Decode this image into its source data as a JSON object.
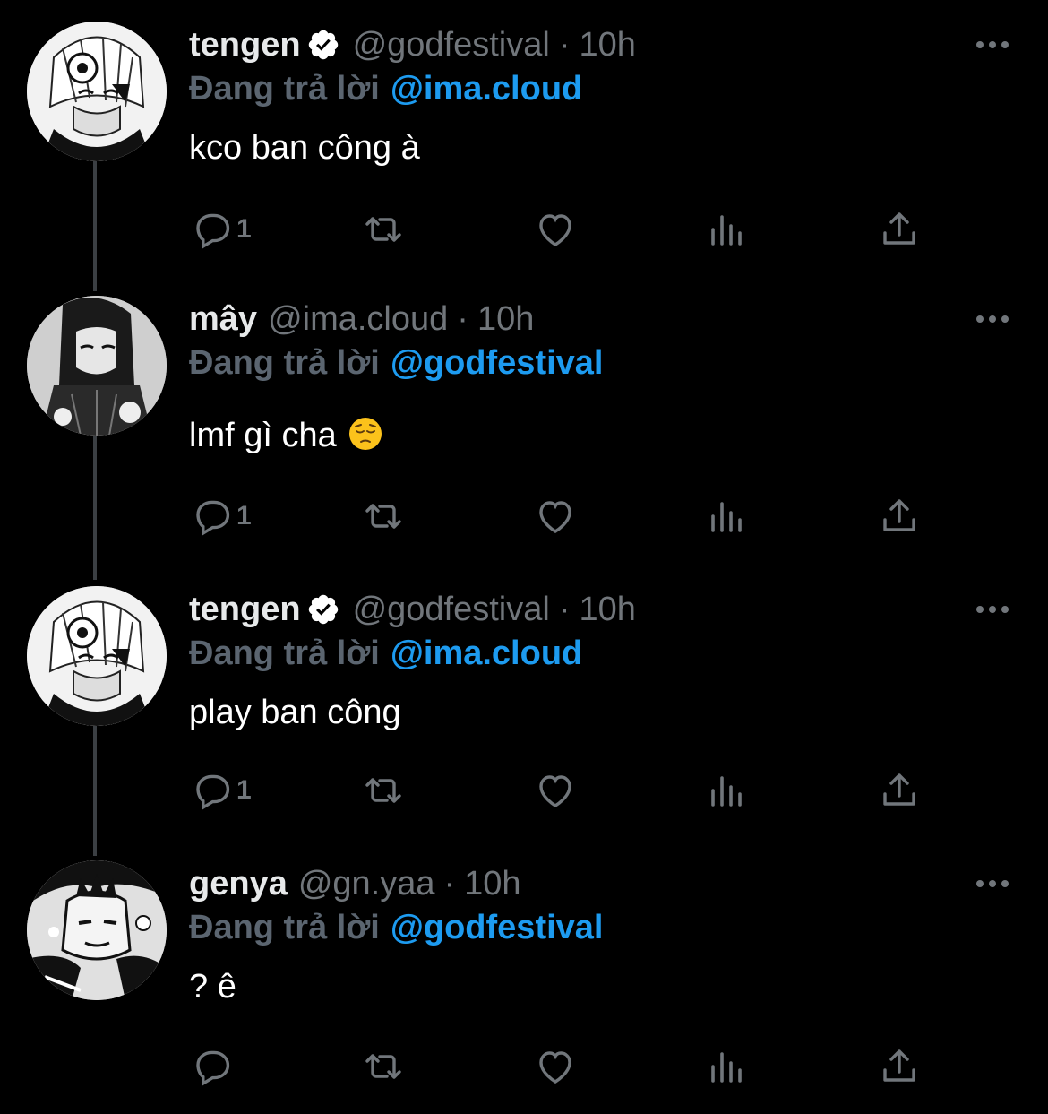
{
  "tweets": [
    {
      "name": "tengen",
      "verified": true,
      "handle": "@godfestival",
      "dot": "·",
      "time": "10h",
      "reply_prefix": "Đang trả lời",
      "reply_to": "@ima.cloud",
      "text": "kco ban công à",
      "emoji": "",
      "reply_count": "1",
      "avatar": "tengen-avatar"
    },
    {
      "name": "mây",
      "verified": false,
      "handle": "@ima.cloud",
      "dot": "·",
      "time": "10h",
      "reply_prefix": "Đang trả lời",
      "reply_to": "@godfestival",
      "text": "lmf gì cha",
      "emoji": "pensive-face",
      "reply_count": "1",
      "avatar": "may-avatar"
    },
    {
      "name": "tengen",
      "verified": true,
      "handle": "@godfestival",
      "dot": "·",
      "time": "10h",
      "reply_prefix": "Đang trả lời",
      "reply_to": "@ima.cloud",
      "text": "play ban công",
      "emoji": "",
      "reply_count": "1",
      "avatar": "tengen-avatar"
    },
    {
      "name": "genya",
      "verified": false,
      "handle": "@gn.yaa",
      "dot": "·",
      "time": "10h",
      "reply_prefix": "Đang trả lời",
      "reply_to": "@godfestival",
      "text": "? ê",
      "emoji": "",
      "reply_count": "",
      "avatar": "genya-avatar"
    }
  ],
  "colors": {
    "background": "#000000",
    "text": "#e7e9ea",
    "muted": "#71767b",
    "link": "#1d9bf0",
    "verified_badge": "#ffffff",
    "thread_line": "#3b3f43"
  }
}
